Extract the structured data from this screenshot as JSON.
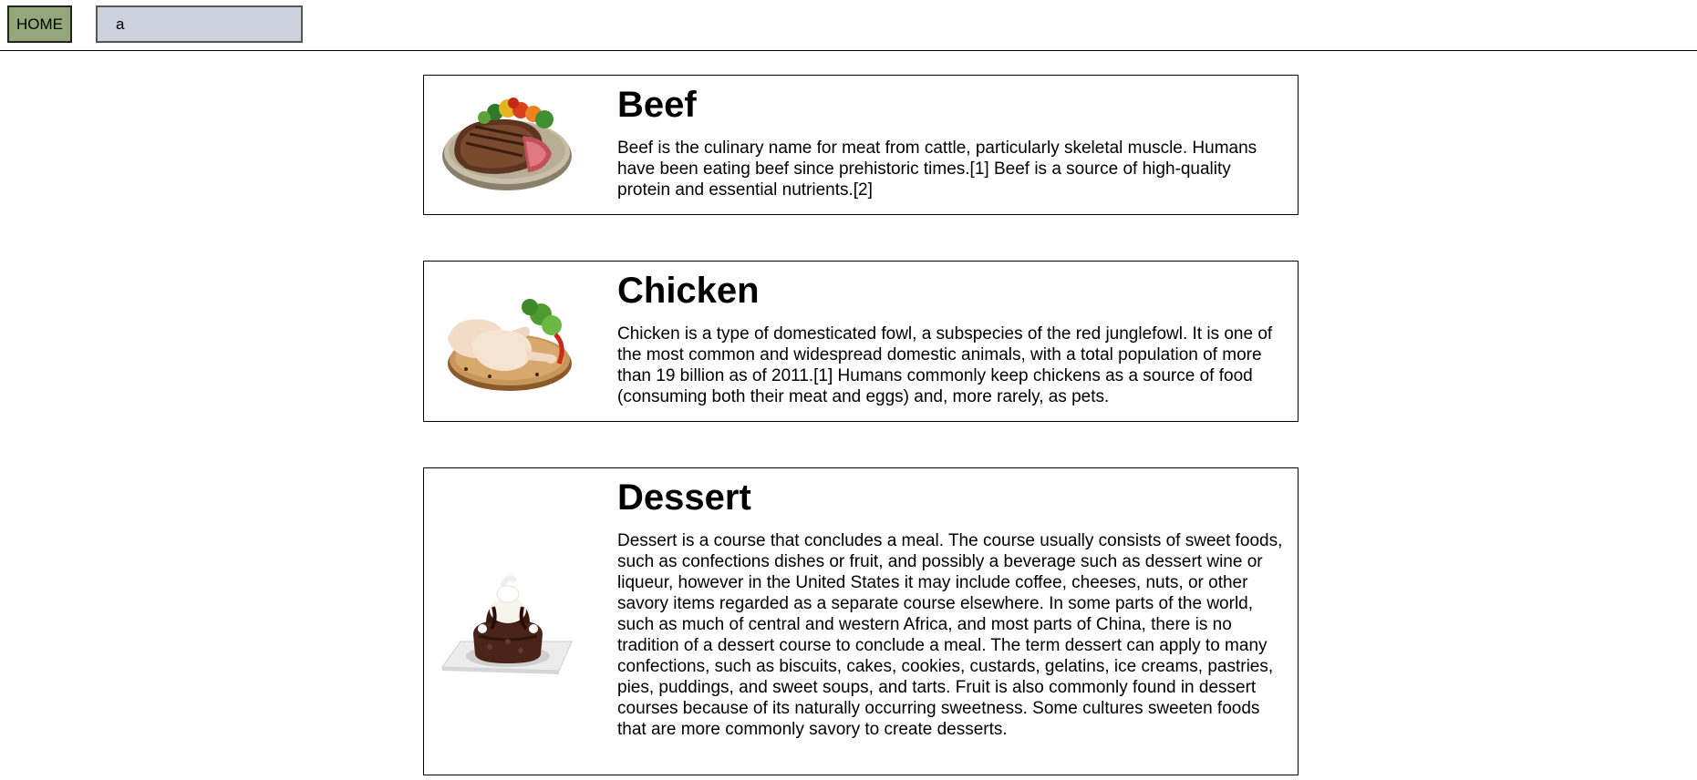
{
  "header": {
    "home_label": "HOME",
    "search_value": "a"
  },
  "cards": [
    {
      "title": "Beef",
      "description": "Beef is the culinary name for meat from cattle, particularly skeletal muscle. Humans have been eating beef since prehistoric times.[1] Beef is a source of high-quality protein and essential nutrients.[2]",
      "image": "beef-steak-image"
    },
    {
      "title": "Chicken",
      "description": "Chicken is a type of domesticated fowl, a subspecies of the red junglefowl. It is one of the most common and widespread domestic animals, with a total population of more than 19 billion as of 2011.[1] Humans commonly keep chickens as a source of food (consuming both their meat and eggs) and, more rarely, as pets.",
      "image": "chicken-legs-image"
    },
    {
      "title": "Dessert",
      "description": "Dessert is a course that concludes a meal. The course usually consists of sweet foods, such as confections dishes or fruit, and possibly a beverage such as dessert wine or liqueur, however in the United States it may include coffee, cheeses, nuts, or other savory items regarded as a separate course elsewhere. In some parts of the world, such as much of central and western Africa, and most parts of China, there is no tradition of a dessert course to conclude a meal. The term dessert can apply to many confections, such as biscuits, cakes, cookies, custards, gelatins, ice creams, pastries, pies, puddings, and sweet soups, and tarts. Fruit is also commonly found in dessert courses because of its naturally occurring sweetness. Some cultures sweeten foods that are more commonly savory to create desserts.",
      "image": "chocolate-cake-image"
    }
  ]
}
